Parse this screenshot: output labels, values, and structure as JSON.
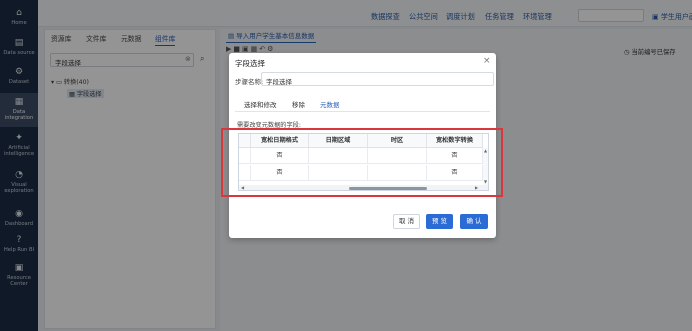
{
  "sidebar": {
    "items": [
      {
        "label": "Home",
        "icon": "home-icon"
      },
      {
        "label": "Data source",
        "icon": "database-icon"
      },
      {
        "label": "Dataset",
        "icon": "dataset-icon"
      },
      {
        "label": "Data integration",
        "icon": "integration-icon"
      },
      {
        "label": "Artificial intelligence",
        "icon": "ai-icon"
      },
      {
        "label": "Visual exploration",
        "icon": "visual-icon"
      },
      {
        "label": "Dashboard",
        "icon": "dashboard-icon"
      },
      {
        "label": "Help Run BI",
        "icon": "help-icon"
      },
      {
        "label": "Resource Center",
        "icon": "resource-icon"
      }
    ]
  },
  "topbar": {
    "links": [
      "数据探查",
      "公共空间",
      "调度计划",
      "任务管理",
      "环境管理"
    ],
    "user": "学生用户画像标..."
  },
  "left_panel": {
    "tabs": [
      "资源库",
      "文件库",
      "元数据",
      "组件库"
    ],
    "search_value": "字段选择",
    "tree_root": "转换(40)",
    "tree_child": "字段选择"
  },
  "main": {
    "tab_label": "导入用户学生基本信息数据",
    "save_info": "当前编号已保存"
  },
  "dialog": {
    "title": "字段选择",
    "step_label": "步骤名称:",
    "step_value": "字段选择",
    "tabs": [
      "选择和修改",
      "移除",
      "元数据"
    ],
    "hint": "需要改变元数据的字段:",
    "columns": [
      "宽松日期格式",
      "日期区域",
      "时区",
      "宽松数字转换"
    ],
    "rows": [
      [
        "否",
        "",
        "",
        "否"
      ],
      [
        "否",
        "",
        "",
        "否"
      ]
    ],
    "buttons": {
      "cancel": "取 消",
      "preview": "预 览",
      "ok": "确 认"
    }
  },
  "colors": {
    "accent": "#2b6bd6",
    "sidebar": "#1c2c44",
    "highlight_box": "#d9363e"
  }
}
